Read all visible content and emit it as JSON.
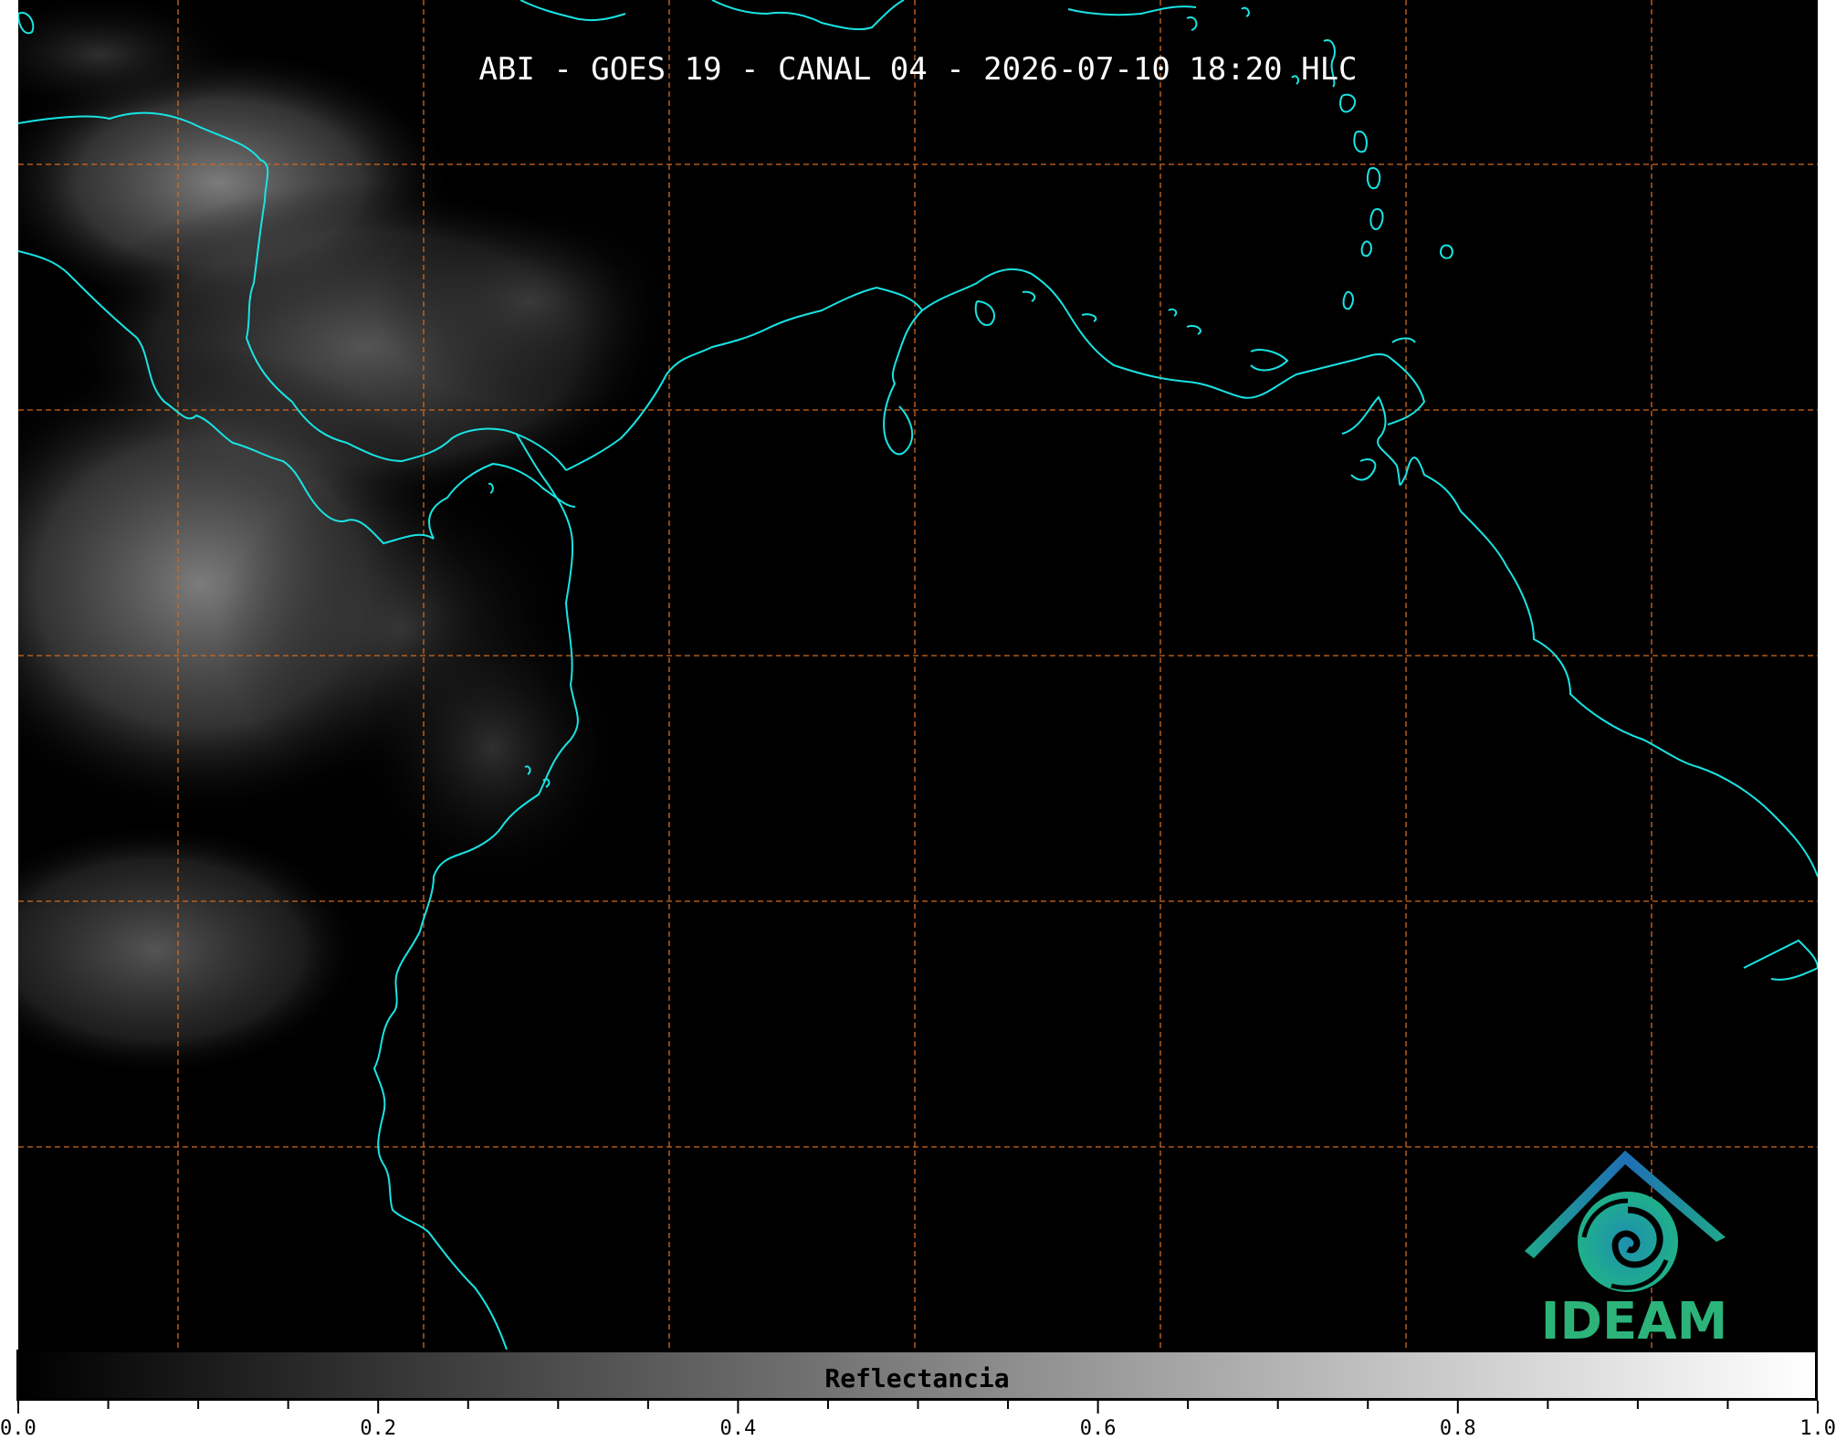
{
  "map": {
    "title": "ABI - GOES 19 - CANAL 04 - 2026-07-10 18:20 HLC",
    "background_color": "#000000",
    "coastline_color": "#19e3e3",
    "gridline_color": "#d2691e",
    "gridlines": "dashed"
  },
  "logo": {
    "text": "IDEAM",
    "text_color": "#2bb37a",
    "roof_color": "#1f6fb5",
    "swirl_color": "#1fa88a"
  },
  "colorbar": {
    "label": "Reflectancia",
    "range": [
      0.0,
      1.0
    ],
    "colormap": "gray",
    "tick_labels": [
      "0.0",
      "0.2",
      "0.4",
      "0.6",
      "0.8",
      "1.0"
    ]
  }
}
